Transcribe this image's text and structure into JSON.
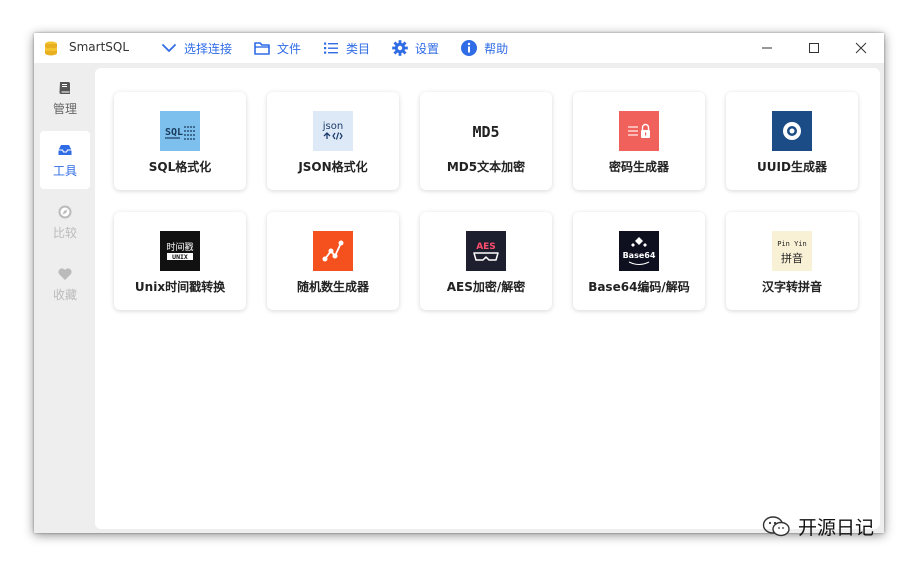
{
  "app": {
    "title": "SmartSQL"
  },
  "menu": [
    {
      "label": "选择连接",
      "icon": "chevron-down-icon"
    },
    {
      "label": "文件",
      "icon": "folder-icon"
    },
    {
      "label": "类目",
      "icon": "list-icon"
    },
    {
      "label": "设置",
      "icon": "gear-icon"
    },
    {
      "label": "帮助",
      "icon": "info-icon"
    }
  ],
  "sidebar": [
    {
      "label": "管理",
      "icon": "book-icon",
      "state": "normal"
    },
    {
      "label": "工具",
      "icon": "inbox-icon",
      "state": "active"
    },
    {
      "label": "比较",
      "icon": "compass-icon",
      "state": "disabled"
    },
    {
      "label": "收藏",
      "icon": "heart-icon",
      "state": "disabled"
    }
  ],
  "tools": [
    {
      "label": "SQL格式化",
      "icon": "sql-format-icon",
      "icon_text": "SQL"
    },
    {
      "label": "JSON格式化",
      "icon": "json-format-icon",
      "icon_text": "json"
    },
    {
      "label": "MD5文本加密",
      "icon": "md5-icon",
      "icon_text": "MD5"
    },
    {
      "label": "密码生成器",
      "icon": "password-generator-icon"
    },
    {
      "label": "UUID生成器",
      "icon": "uuid-icon"
    },
    {
      "label": "Unix时间戳转换",
      "icon": "unix-timestamp-icon",
      "icon_text": "时间戳",
      "icon_text2": "UNIX"
    },
    {
      "label": "随机数生成器",
      "icon": "random-number-icon"
    },
    {
      "label": "AES加密/解密",
      "icon": "aes-icon",
      "icon_text": "AES"
    },
    {
      "label": "Base64编码/解码",
      "icon": "base64-icon",
      "icon_text": "Base64"
    },
    {
      "label": "汉字转拼音",
      "icon": "pinyin-icon",
      "icon_text": "Pin Yin",
      "icon_text2": "拼音"
    }
  ],
  "watermark": {
    "text": "开源日记",
    "icon": "wechat-icon"
  },
  "colors": {
    "accent": "#2f6ce5",
    "window_bg": "#eeeeee",
    "card_bg": "#ffffff"
  }
}
